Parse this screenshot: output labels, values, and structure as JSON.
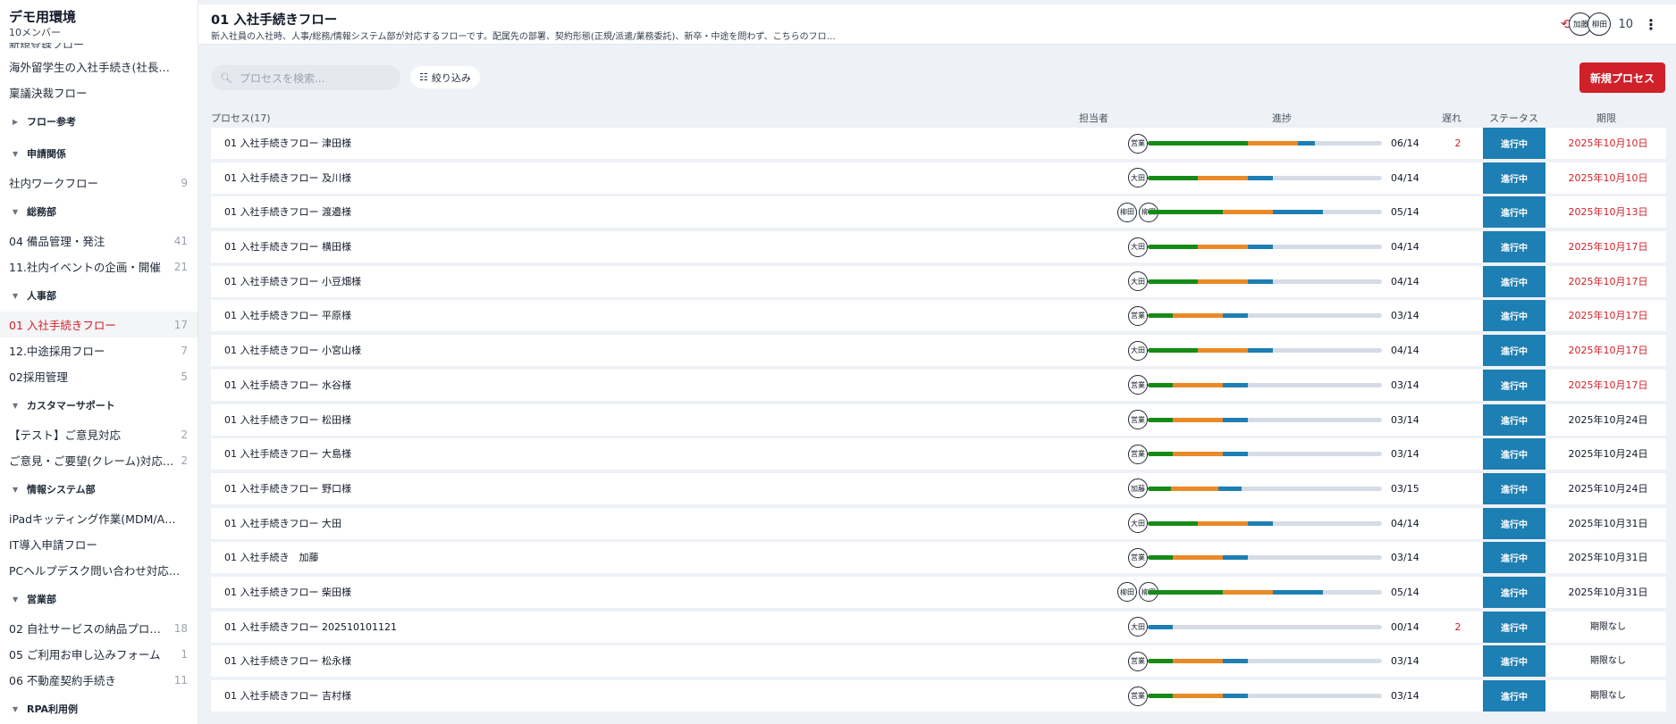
{
  "workspace": {
    "name": "デモ用環境",
    "members": "10メンバー",
    "cutoff_item": "新規登録フロー"
  },
  "sidebar": [
    {
      "type": "item",
      "label": "海外留学生の入社手続き(社長承…",
      "count": ""
    },
    {
      "type": "item",
      "label": "稟議決裁フロー",
      "count": ""
    },
    {
      "type": "group",
      "label": "フロー参考",
      "expanded": false
    },
    {
      "type": "group",
      "label": "申請関係",
      "expanded": true
    },
    {
      "type": "item",
      "label": "社内ワークフロー",
      "count": "9"
    },
    {
      "type": "group",
      "label": "総務部",
      "expanded": true
    },
    {
      "type": "item",
      "label": "04 備品管理・発注",
      "count": "41"
    },
    {
      "type": "item",
      "label": "11.社内イベントの企画・開催",
      "count": "21"
    },
    {
      "type": "group",
      "label": "人事部",
      "expanded": true
    },
    {
      "type": "item",
      "label": "01 入社手続きフロー",
      "count": "17",
      "active": true
    },
    {
      "type": "item",
      "label": "12.中途採用フロー",
      "count": "7"
    },
    {
      "type": "item",
      "label": "02採用管理",
      "count": "5"
    },
    {
      "type": "group",
      "label": "カスタマーサポート",
      "expanded": true
    },
    {
      "type": "item",
      "label": "【テスト】ご意見対応",
      "count": "2"
    },
    {
      "type": "item",
      "label": "ご意見・ご要望(クレーム)対応フ…",
      "count": "2"
    },
    {
      "type": "group",
      "label": "情報システム部",
      "expanded": true
    },
    {
      "type": "item",
      "label": "iPadキッティング作業(MDM/A…",
      "count": ""
    },
    {
      "type": "item",
      "label": "IT導入申請フロー",
      "count": ""
    },
    {
      "type": "item",
      "label": "PCヘルプデスク問い合わせ対応…",
      "count": ""
    },
    {
      "type": "group",
      "label": "営業部",
      "expanded": true
    },
    {
      "type": "item",
      "label": "02 自社サービスの納品プロセス",
      "count": "18"
    },
    {
      "type": "item",
      "label": "05 ご利用お申し込みフォーム",
      "count": "1"
    },
    {
      "type": "item",
      "label": "06 不動産契約手続き",
      "count": "11"
    },
    {
      "type": "group",
      "label": "RPA利用例",
      "expanded": true
    }
  ],
  "header": {
    "title": "01 入社手続きフロー",
    "description": "新入社員の入社時、人事/総務/情報システム部が対応するフローです。配属先の部署、契約形態(正規/派遣/業務委託)、新卒・中途を問わず、こちらのフローを使…",
    "member_avatars": [
      "加藤",
      "柳田"
    ],
    "member_count": "10",
    "more_icon": "⋮",
    "notification_icon": "⟲"
  },
  "toolbar": {
    "search_placeholder": "プロセスを検索...",
    "filter_label": "絞り込み",
    "new_process_label": "新規プロセス"
  },
  "columns": {
    "process": "プロセス(17)",
    "owner": "担当者",
    "progress": "進捗",
    "late": "遅れ",
    "status": "ステータス",
    "due": "期限"
  },
  "colors": {
    "accent": "#d0202a",
    "status_blue": "#1d7fb3",
    "done": "#168a17",
    "in_progress": "#e98a27",
    "waiting": "#1d7fb3",
    "track": "#d5dce5"
  },
  "processes": [
    {
      "name": "01 入社手続きフロー 津田様",
      "owners": [
        "営業"
      ],
      "progress": "06/14",
      "done": 6,
      "active": 3,
      "waiting": 1,
      "total": 14,
      "late": "2",
      "status": "進行中",
      "due": "2025年10月10日",
      "overdue": true
    },
    {
      "name": "01 入社手続きフロー 及川様",
      "owners": [
        "大田"
      ],
      "progress": "04/14",
      "done": 3,
      "active": 3,
      "waiting": 1.5,
      "total": 14,
      "late": "",
      "status": "進行中",
      "due": "2025年10月10日",
      "overdue": true
    },
    {
      "name": "01 入社手続きフロー 渡邉様",
      "owners": [
        "柳田",
        "柳田"
      ],
      "progress": "05/14",
      "done": 4.5,
      "active": 3,
      "waiting": 3,
      "total": 14,
      "late": "",
      "status": "進行中",
      "due": "2025年10月13日",
      "overdue": true
    },
    {
      "name": "01 入社手続きフロー 横田様",
      "owners": [
        "大田"
      ],
      "progress": "04/14",
      "done": 3,
      "active": 3,
      "waiting": 1.5,
      "total": 14,
      "late": "",
      "status": "進行中",
      "due": "2025年10月17日",
      "overdue": true
    },
    {
      "name": "01 入社手続きフロー 小豆畑様",
      "owners": [
        "大田"
      ],
      "progress": "04/14",
      "done": 3,
      "active": 3,
      "waiting": 1.5,
      "total": 14,
      "late": "",
      "status": "進行中",
      "due": "2025年10月17日",
      "overdue": true
    },
    {
      "name": "01 入社手続きフロー 平原様",
      "owners": [
        "営業"
      ],
      "progress": "03/14",
      "done": 1.5,
      "active": 3,
      "waiting": 1.5,
      "total": 14,
      "late": "",
      "status": "進行中",
      "due": "2025年10月17日",
      "overdue": true
    },
    {
      "name": "01 入社手続きフロー 小宮山様",
      "owners": [
        "大田"
      ],
      "progress": "04/14",
      "done": 3,
      "active": 3,
      "waiting": 1.5,
      "total": 14,
      "late": "",
      "status": "進行中",
      "due": "2025年10月17日",
      "overdue": true
    },
    {
      "name": "01 入社手続きフロー 水谷様",
      "owners": [
        "営業"
      ],
      "progress": "03/14",
      "done": 1.5,
      "active": 3,
      "waiting": 1.5,
      "total": 14,
      "late": "",
      "status": "進行中",
      "due": "2025年10月17日",
      "overdue": true
    },
    {
      "name": "01 入社手続きフロー 松田様",
      "owners": [
        "営業"
      ],
      "progress": "03/14",
      "done": 1.5,
      "active": 3,
      "waiting": 1.5,
      "total": 14,
      "late": "",
      "status": "進行中",
      "due": "2025年10月24日",
      "overdue": false
    },
    {
      "name": "01 入社手続きフロー 大島様",
      "owners": [
        "営業"
      ],
      "progress": "03/14",
      "done": 1.5,
      "active": 3,
      "waiting": 1.5,
      "total": 14,
      "late": "",
      "status": "進行中",
      "due": "2025年10月24日",
      "overdue": false
    },
    {
      "name": "01 入社手続きフロー 野口様",
      "owners": [
        "加藤"
      ],
      "progress": "03/15",
      "done": 1.5,
      "active": 3,
      "waiting": 1.5,
      "total": 15,
      "late": "",
      "status": "進行中",
      "due": "2025年10月24日",
      "overdue": false
    },
    {
      "name": "01 入社手続きフロー 大田",
      "owners": [
        "大田"
      ],
      "progress": "04/14",
      "done": 3,
      "active": 3,
      "waiting": 1.5,
      "total": 14,
      "late": "",
      "status": "進行中",
      "due": "2025年10月31日",
      "overdue": false
    },
    {
      "name": "01 入社手続き　加藤",
      "owners": [
        "営業"
      ],
      "progress": "03/14",
      "done": 1.5,
      "active": 3,
      "waiting": 1.5,
      "total": 14,
      "late": "",
      "status": "進行中",
      "due": "2025年10月31日",
      "overdue": false
    },
    {
      "name": "01 入社手続きフロー 柴田様",
      "owners": [
        "柳田",
        "柳田"
      ],
      "progress": "05/14",
      "done": 4.5,
      "active": 3,
      "waiting": 3,
      "total": 14,
      "late": "",
      "status": "進行中",
      "due": "2025年10月31日",
      "overdue": false
    },
    {
      "name": "01 入社手続きフロー 202510101121",
      "owners": [
        "大田"
      ],
      "progress": "00/14",
      "done": 0,
      "active": 0,
      "waiting": 1.5,
      "total": 14,
      "late": "2",
      "status": "進行中",
      "due": "期限なし",
      "overdue": false,
      "no_due": true
    },
    {
      "name": "01 入社手続きフロー 松永様",
      "owners": [
        "営業"
      ],
      "progress": "03/14",
      "done": 1.5,
      "active": 3,
      "waiting": 1.5,
      "total": 14,
      "late": "",
      "status": "進行中",
      "due": "期限なし",
      "overdue": false,
      "no_due": true
    },
    {
      "name": "01 入社手続きフロー 吉村様",
      "owners": [
        "営業"
      ],
      "progress": "03/14",
      "done": 1.5,
      "active": 3,
      "waiting": 1.5,
      "total": 14,
      "late": "",
      "status": "進行中",
      "due": "期限なし",
      "overdue": false,
      "no_due": true
    }
  ]
}
